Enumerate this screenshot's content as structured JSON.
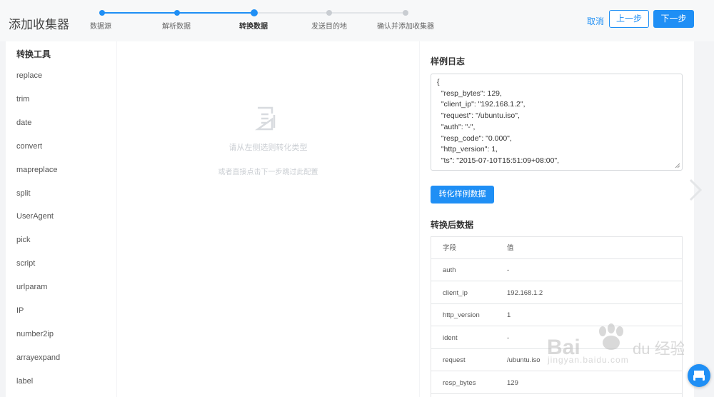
{
  "header": {
    "title": "添加收集器",
    "steps": [
      {
        "label": "数据源",
        "state": "done"
      },
      {
        "label": "解析数据",
        "state": "done"
      },
      {
        "label": "转换数据",
        "state": "active"
      },
      {
        "label": "发送目的地",
        "state": "todo"
      },
      {
        "label": "确认并添加收集器",
        "state": "todo"
      }
    ],
    "cancel_label": "取消",
    "prev_label": "上一步",
    "next_label": "下一步"
  },
  "sidebar": {
    "title": "转换工具",
    "tools": [
      "replace",
      "trim",
      "date",
      "convert",
      "mapreplace",
      "split",
      "UserAgent",
      "pick",
      "script",
      "urlparam",
      "IP",
      "number2ip",
      "arrayexpand",
      "label"
    ]
  },
  "center": {
    "hint_primary": "请从左侧选则转化类型",
    "hint_secondary": "或者直接点击下一步跳过此配置"
  },
  "sample": {
    "title": "样例日志",
    "lines": [
      "{",
      "  \"resp_bytes\": 129,",
      "  \"client_ip\": \"192.168.1.2\",",
      "  \"request\": \"/ubuntu.iso\",",
      "  \"auth\": \"-\",",
      "  \"resp_code\": \"0.000\",",
      "  \"http_version\": 1,",
      "  \"ts\": \"2015-07-10T15:51:09+08:00\","
    ],
    "convert_label": "转化样例数据"
  },
  "result": {
    "title": "转换后数据",
    "header": {
      "field": "字段",
      "value": "值"
    },
    "rows": [
      {
        "field": "auth",
        "value": "-"
      },
      {
        "field": "client_ip",
        "value": "192.168.1.2"
      },
      {
        "field": "http_version",
        "value": "1"
      },
      {
        "field": "ident",
        "value": "-"
      },
      {
        "field": "request",
        "value": "/ubuntu.iso"
      },
      {
        "field": "resp_bytes",
        "value": "129"
      }
    ]
  },
  "watermark": {
    "text": "jingyan.baidu.com",
    "logo": "Bai du 经验"
  },
  "colors": {
    "accent": "#1f8ff5",
    "inactive": "#c9cdd2",
    "panel": "#ffffff",
    "background": "#f3f4f6"
  }
}
